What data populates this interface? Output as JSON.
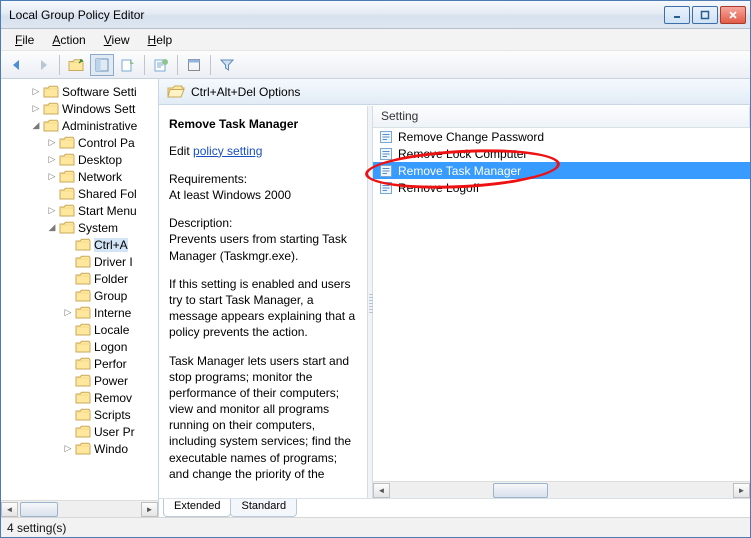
{
  "window": {
    "title": "Local Group Policy Editor"
  },
  "menu": {
    "file": "File",
    "action": "Action",
    "view": "View",
    "help": "Help"
  },
  "tree": {
    "nodes": [
      {
        "indent": 2,
        "tw": "▷",
        "label": "Software Setti"
      },
      {
        "indent": 2,
        "tw": "▷",
        "label": "Windows Sett"
      },
      {
        "indent": 2,
        "tw": "◢",
        "label": "Administrative"
      },
      {
        "indent": 3,
        "tw": "▷",
        "label": "Control Pa"
      },
      {
        "indent": 3,
        "tw": "▷",
        "label": "Desktop"
      },
      {
        "indent": 3,
        "tw": "▷",
        "label": "Network"
      },
      {
        "indent": 3,
        "tw": "",
        "label": "Shared Fol"
      },
      {
        "indent": 3,
        "tw": "▷",
        "label": "Start Menu"
      },
      {
        "indent": 3,
        "tw": "◢",
        "label": "System"
      },
      {
        "indent": 4,
        "tw": "",
        "label": "Ctrl+A",
        "sel": true
      },
      {
        "indent": 4,
        "tw": "",
        "label": "Driver I"
      },
      {
        "indent": 4,
        "tw": "",
        "label": "Folder"
      },
      {
        "indent": 4,
        "tw": "",
        "label": "Group"
      },
      {
        "indent": 4,
        "tw": "▷",
        "label": "Interne"
      },
      {
        "indent": 4,
        "tw": "",
        "label": "Locale"
      },
      {
        "indent": 4,
        "tw": "",
        "label": "Logon"
      },
      {
        "indent": 4,
        "tw": "",
        "label": "Perfor"
      },
      {
        "indent": 4,
        "tw": "",
        "label": "Power"
      },
      {
        "indent": 4,
        "tw": "",
        "label": "Remov"
      },
      {
        "indent": 4,
        "tw": "",
        "label": "Scripts"
      },
      {
        "indent": 4,
        "tw": "",
        "label": "User Pr"
      },
      {
        "indent": 4,
        "tw": "▷",
        "label": "Windo"
      }
    ]
  },
  "header": {
    "title": "Ctrl+Alt+Del Options"
  },
  "desc": {
    "title": "Remove Task Manager",
    "edit_prefix": "Edit ",
    "edit_link": "policy setting",
    "req_label": "Requirements:",
    "req_text": "At least Windows 2000",
    "desc_label": "Description:",
    "p1": "Prevents users from starting Task Manager (Taskmgr.exe).",
    "p2": "If this setting is enabled and users try to start Task Manager, a message appears explaining that a policy prevents the action.",
    "p3": "Task Manager lets users start and stop programs; monitor the performance of their computers; view and monitor all programs running on their computers, including system services; find the executable names of programs; and change the priority of the"
  },
  "list": {
    "col": "Setting",
    "rows": [
      {
        "label": "Remove Change Password"
      },
      {
        "label": "Remove Lock Computer"
      },
      {
        "label": "Remove Task Manager",
        "sel": true
      },
      {
        "label": "Remove Logoff"
      }
    ]
  },
  "tabs": {
    "extended": "Extended",
    "standard": "Standard"
  },
  "status": {
    "text": "4 setting(s)"
  }
}
